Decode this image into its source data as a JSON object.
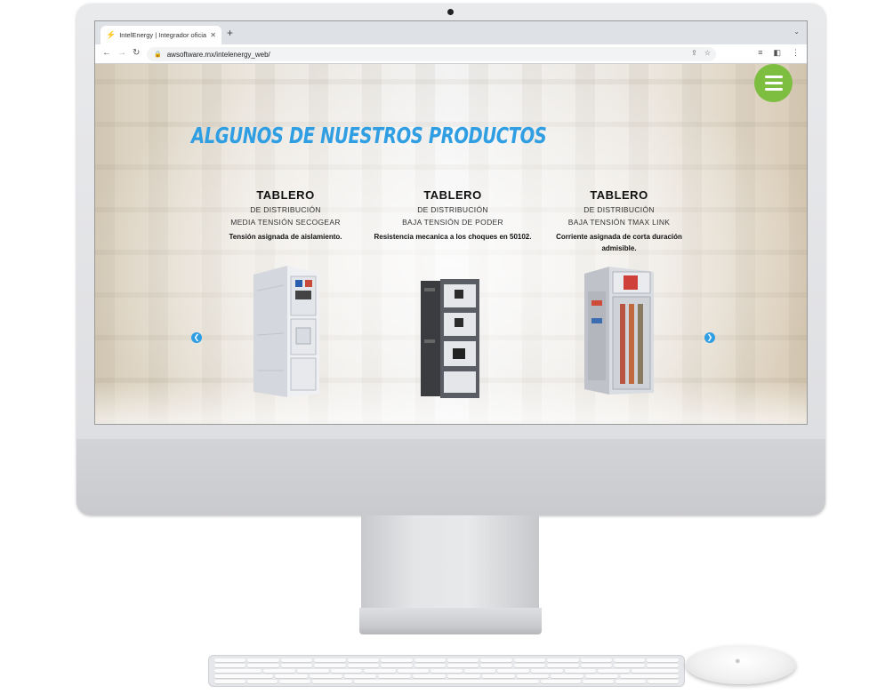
{
  "browser": {
    "tab_title": "IntelEnergy | Integrador oficial",
    "tab_favicon": "lightning-icon",
    "url": "awsoftware.mx/intelenergy_web/"
  },
  "page": {
    "section_title": "ALGUNOS DE NUESTROS PRODUCTOS",
    "accent_color": "#2f9ee3",
    "menu_color": "#7dbd40",
    "products": [
      {
        "title": "TABLERO",
        "subtitle": "DE DISTRIBUCIÓN",
        "subtitle2": "MEDIA TENSIÓN SECOGEAR",
        "description": "Tensión asignada de aislamiento."
      },
      {
        "title": "TABLERO",
        "subtitle": "DE DISTRIBUCIÓN",
        "subtitle2": "BAJA TENSIÓN DE PODER",
        "description": "Resistencia mecanica a los choques en 50102."
      },
      {
        "title": "TABLERO",
        "subtitle": "DE DISTRIBUCIÓN",
        "subtitle2": "BAJA TENSIÓN TMAX LINK",
        "description": "Corriente asignada de corta duración admisible."
      }
    ]
  }
}
